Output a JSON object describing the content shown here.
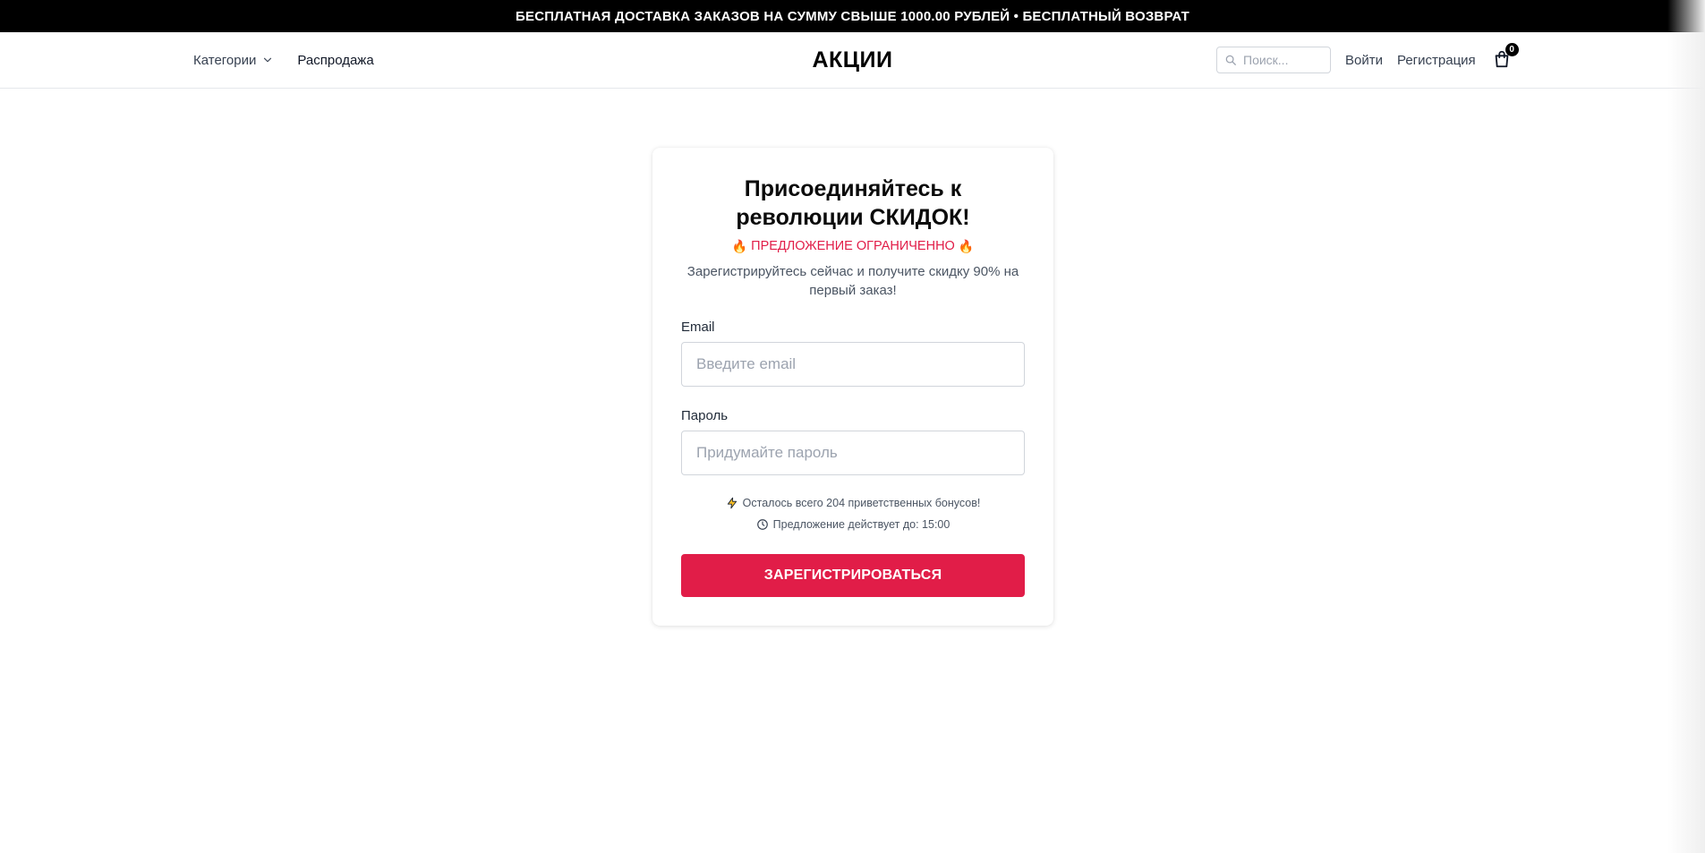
{
  "announcement": {
    "text": "БЕСПЛАТНАЯ ДОСТАВКА ЗАКАЗОВ НА СУММУ СВЫШЕ 1000.00 РУБЛЕЙ • БЕСПЛАТНЫЙ ВОЗВРАТ"
  },
  "header": {
    "categories_label": "Категории",
    "sale_label": "Распродажа",
    "brand": "АКЦИИ",
    "search_placeholder": "Поиск...",
    "login_label": "Войти",
    "register_label": "Регистрация",
    "cart_count": "0",
    "icons": {
      "categories": "chevron-down-icon",
      "search": "search-icon",
      "cart": "shopping-bag-icon"
    }
  },
  "signup": {
    "title": "Присоединяйтесь к революции СКИДОК!",
    "limited_fire_left": "🔥",
    "limited_text": "ПРЕДЛОЖЕНИЕ ОГРАНИЧЕННО",
    "limited_fire_right": "🔥",
    "subtitle": "Зарегистрируйтесь сейчас и получите скидку 90% на первый заказ!",
    "email_label": "Email",
    "email_placeholder": "Введите email",
    "email_value": "",
    "password_label": "Пароль",
    "password_placeholder": "Придумайте пароль",
    "password_value": "",
    "bonus_note": "Осталось всего 204 приветственных бонусов!",
    "timer_note": "Предложение действует до: 15:00",
    "submit_label": "ЗАРЕГИСТРИРОВАТЬСЯ",
    "icons": {
      "bonus": "lightning-icon",
      "timer": "clock-icon",
      "limited": "fire-icon"
    }
  },
  "colors": {
    "accent": "#e11d48",
    "announcement_bg": "#000000",
    "text_primary": "#111827",
    "text_muted": "#4b5563",
    "border": "#d1d5db"
  }
}
